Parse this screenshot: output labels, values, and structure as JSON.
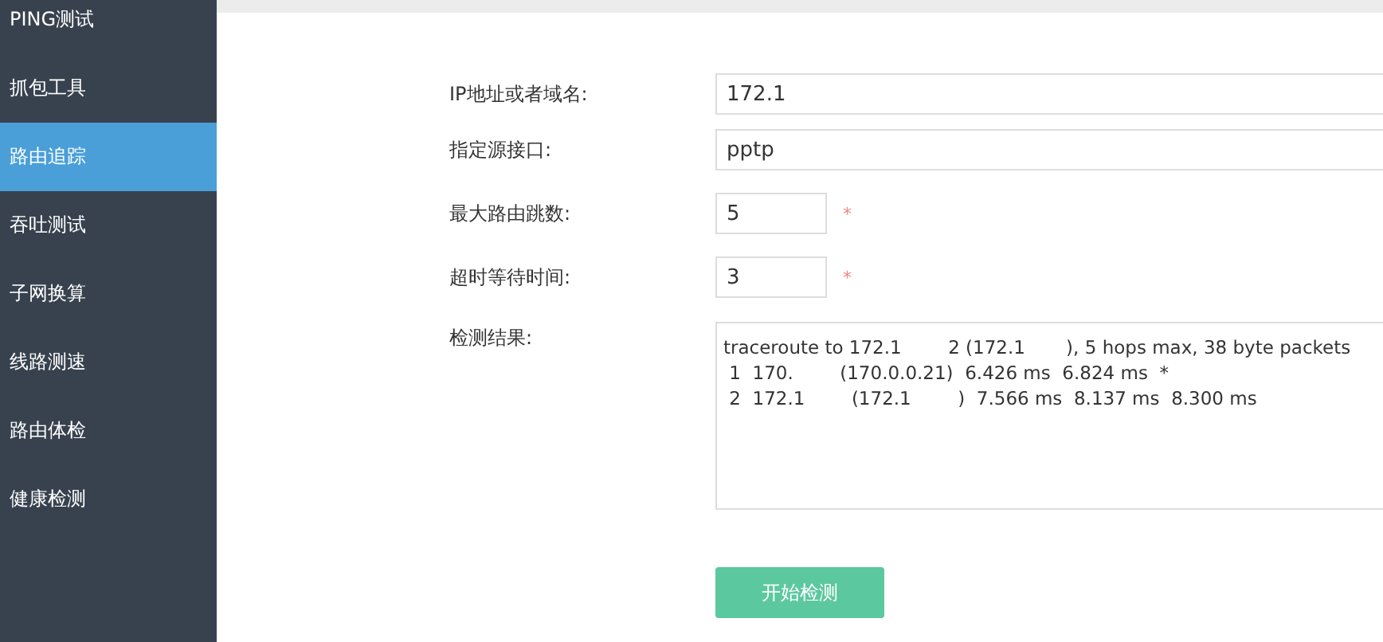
{
  "sidebar": {
    "items": [
      {
        "label": "PING测试",
        "selected": false
      },
      {
        "label": "抓包工具",
        "selected": false
      },
      {
        "label": "路由追踪",
        "selected": true
      },
      {
        "label": "吞吐测试",
        "selected": false
      },
      {
        "label": "子网换算",
        "selected": false
      },
      {
        "label": "线路测速",
        "selected": false
      },
      {
        "label": "路由体检",
        "selected": false
      },
      {
        "label": "健康检测",
        "selected": false
      }
    ]
  },
  "form": {
    "fields": [
      {
        "label": "IP地址或者域名:",
        "value": "172.1",
        "kind": "wide"
      },
      {
        "label": "指定源接口:",
        "value": "pptp",
        "kind": "wide"
      },
      {
        "label": "最大路由跳数:",
        "value": "5",
        "kind": "short",
        "required_mark": "*"
      },
      {
        "label": "超时等待时间:",
        "value": "3",
        "kind": "short",
        "required_mark": "*"
      }
    ],
    "result": {
      "label": "检测结果:",
      "lines": [
        "traceroute to 172.1        2 (172.1       ), 5 hops max, 38 byte packets",
        " 1  170.        (170.0.0.21)  6.426 ms  6.824 ms  *",
        " 2  172.1        (172.1        )  7.566 ms  8.137 ms  8.300 ms"
      ]
    },
    "submit": "开始检测"
  }
}
